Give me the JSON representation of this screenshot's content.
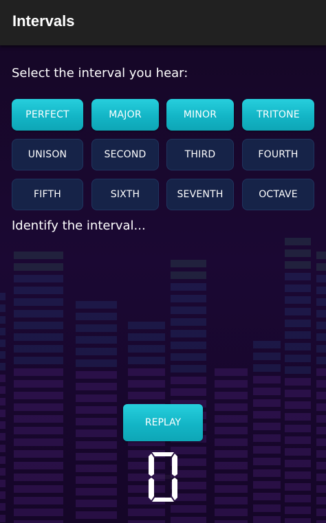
{
  "app": {
    "title": "Intervals"
  },
  "prompt": "Select the interval you hear:",
  "categories": [
    "PERFECT",
    "MAJOR",
    "MINOR",
    "TRITONE"
  ],
  "degrees": [
    "UNISON",
    "SECOND",
    "THIRD",
    "FOURTH",
    "FIFTH",
    "SIXTH",
    "SEVENTH",
    "OCTAVE"
  ],
  "status": "Identify the interval...",
  "replay_label": "REPLAY",
  "score": "0",
  "colors": {
    "appbar": "#212121",
    "accent": "#13b5c6",
    "degree_button": "#162c50",
    "background": "#1b0833"
  }
}
